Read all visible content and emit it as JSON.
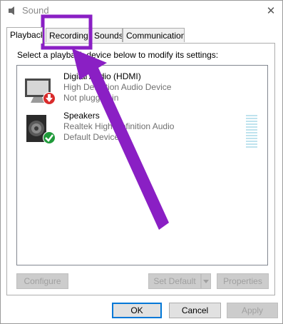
{
  "window": {
    "title": "Sound",
    "close_glyph": "✕"
  },
  "tabs": [
    {
      "label": "Playback",
      "selected": true
    },
    {
      "label": "Recording",
      "selected": false
    },
    {
      "label": "Sounds",
      "selected": false
    },
    {
      "label": "Communications",
      "selected": false
    }
  ],
  "instruction": "Select a playback device below to modify its settings:",
  "devices": [
    {
      "name": "Digital Audio (HDMI)",
      "description": "High Definition Audio Device",
      "status": "Not plugged in",
      "icon": "monitor-icon",
      "badge": "red-down-arrow-badge"
    },
    {
      "name": "Speakers",
      "description": "Realtek High Definition Audio",
      "status": "Default Device",
      "icon": "speaker-icon",
      "badge": "green-check-badge"
    }
  ],
  "buttons": {
    "configure": "Configure",
    "set_default": "Set Default",
    "properties": "Properties",
    "ok": "OK",
    "cancel": "Cancel",
    "apply": "Apply"
  },
  "annotation": {
    "color": "#8a1fc4",
    "target": "Recording"
  },
  "colors": {
    "annotation_purple": "#8a1fc4",
    "focus_blue": "#0078d7",
    "level_meter": "#bfe3ee"
  }
}
